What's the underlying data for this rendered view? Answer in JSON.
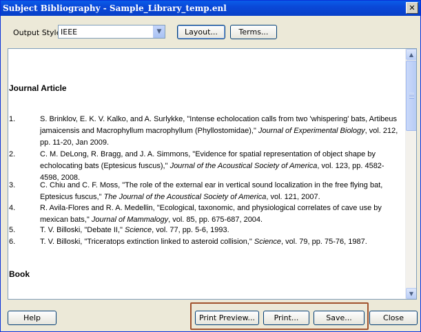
{
  "window": {
    "title": "Subject Bibliography - Sample_Library_temp.enl",
    "close_glyph": "✕"
  },
  "toolbar": {
    "output_style_label": "Output Style:",
    "output_style_value": "IEEE",
    "layout_button": "Layout...",
    "terms_button": "Terms..."
  },
  "document": {
    "journal_heading": "Journal Article",
    "book_heading": "Book",
    "references": [
      {
        "num": "1.",
        "html": "S. Brinklov, E. K. V. Kalko, and A. Surlykke, \"Intense echolocation calls from two 'whispering' bats, Artibeus jamaicensis and Macrophyllum macrophyllum (Phyllostomidae),\" <i>Journal of Experimental Biology</i>, vol. 212, pp. 11-20, Jan 2009."
      },
      {
        "num": "2.",
        "html": "C. M. DeLong, R. Bragg, and J. A. Simmons, \"Evidence for spatial representation of object shape by echolocating bats (Eptesicus fuscus),\" <i>Journal of the Acoustical Society of America</i>, vol. 123, pp. 4582-4598, 2008."
      },
      {
        "num": "3.",
        "html": "C. Chiu and C. F. Moss, \"The role of the external ear in vertical sound localization in the free flying bat, Eptesicus fuscus,\" <i>The Journal of the Acoustical Society of America</i>, vol. 121, 2007."
      },
      {
        "num": "4.",
        "html": "R. Avila-Flores and R. A. Medellin, \"Ecological, taxonomic, and physiological correlates of cave use by mexican bats,\" <i>Journal of Mammalogy</i>, vol. 85, pp. 675-687, 2004."
      },
      {
        "num": "5.",
        "html": "T. V. Billoski, \"Debate II,\" <i>Science</i>, vol. 77, pp. 5-6, 1993."
      },
      {
        "num": "6.",
        "html": "T. V. Billoski, \"Triceratops extinction linked to asteroid collision,\" <i>Science</i>, vol. 79, pp. 75-76, 1987."
      }
    ]
  },
  "footer": {
    "help_button": "Help",
    "print_preview_button": "Print Preview...",
    "print_button": "Print...",
    "save_button": "Save...",
    "close_button": "Close"
  },
  "colors": {
    "titlebar": "#0a48d8",
    "highlight_box": "#a0522d"
  }
}
